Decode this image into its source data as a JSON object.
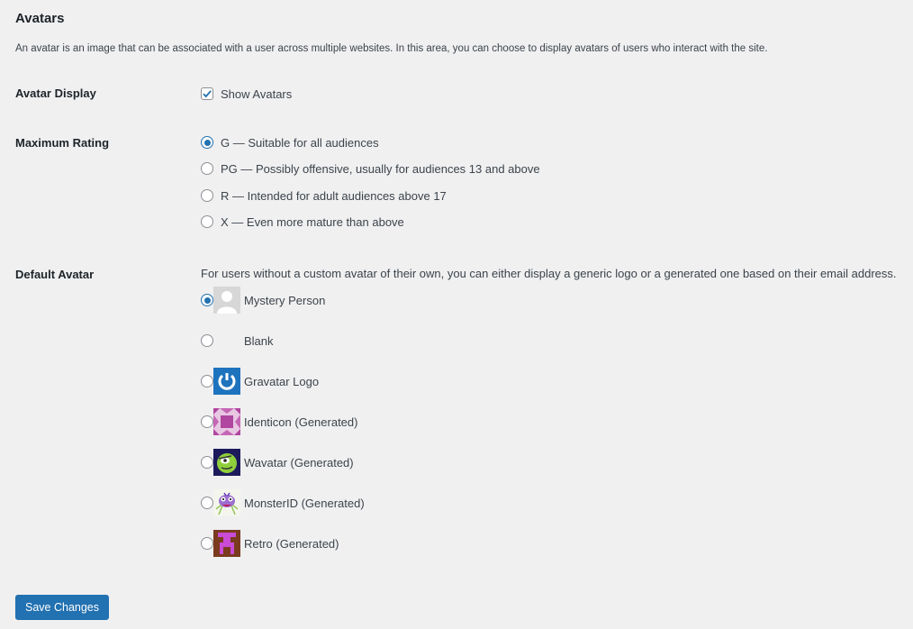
{
  "section": {
    "title": "Avatars",
    "description": "An avatar is an image that can be associated with a user across multiple websites. In this area, you can choose to display avatars of users who interact with the site."
  },
  "avatar_display": {
    "label": "Avatar Display",
    "checkbox_label": "Show Avatars",
    "checked": true
  },
  "maximum_rating": {
    "label": "Maximum Rating",
    "options": [
      {
        "label": "G — Suitable for all audiences",
        "checked": true
      },
      {
        "label": "PG — Possibly offensive, usually for audiences 13 and above",
        "checked": false
      },
      {
        "label": "R — Intended for adult audiences above 17",
        "checked": false
      },
      {
        "label": "X — Even more mature than above",
        "checked": false
      }
    ]
  },
  "default_avatar": {
    "label": "Default Avatar",
    "note": "For users without a custom avatar of their own, you can either display a generic logo or a generated one based on their email address.",
    "options": [
      {
        "label": "Mystery Person",
        "icon": "mystery-person-icon",
        "checked": true
      },
      {
        "label": "Blank",
        "icon": "blank",
        "checked": false
      },
      {
        "label": "Gravatar Logo",
        "icon": "gravatar-logo-icon",
        "checked": false
      },
      {
        "label": "Identicon (Generated)",
        "icon": "identicon-icon",
        "checked": false
      },
      {
        "label": "Wavatar (Generated)",
        "icon": "wavatar-icon",
        "checked": false
      },
      {
        "label": "MonsterID (Generated)",
        "icon": "monsterid-icon",
        "checked": false
      },
      {
        "label": "Retro (Generated)",
        "icon": "retro-icon",
        "checked": false
      }
    ]
  },
  "save_button": {
    "label": "Save Changes"
  },
  "colors": {
    "accent": "#2271b1",
    "background": "#f0f0f1",
    "heading": "#1d2327"
  }
}
